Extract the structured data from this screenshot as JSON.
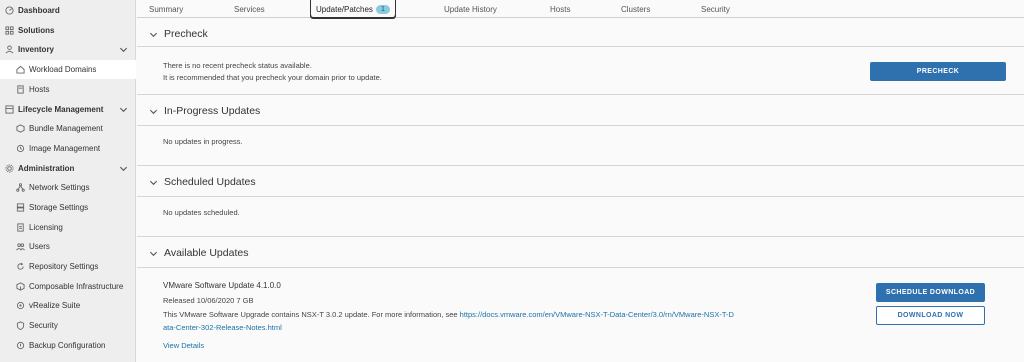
{
  "sidebar": {
    "dashboard": "Dashboard",
    "solutions": "Solutions",
    "inventory": "Inventory",
    "workload_domains": "Workload Domains",
    "hosts": "Hosts",
    "lifecycle": "Lifecycle Management",
    "bundle_management": "Bundle Management",
    "image_management": "Image Management",
    "administration": "Administration",
    "network_settings": "Network Settings",
    "storage_settings": "Storage Settings",
    "licensing": "Licensing",
    "users": "Users",
    "repository_settings": "Repository Settings",
    "composable_infrastructure": "Composable Infrastructure",
    "vrealize_suite": "vRealize Suite",
    "security": "Security",
    "backup_configuration": "Backup Configuration"
  },
  "tabs": {
    "summary": "Summary",
    "services": "Services",
    "update_patches": "Update/Patches",
    "update_patches_badge": "1",
    "update_history": "Update History",
    "hosts": "Hosts",
    "clusters": "Clusters",
    "security": "Security"
  },
  "precheck": {
    "title": "Precheck",
    "line1": "There is no recent precheck status available.",
    "line2": "It is recommended that you precheck your domain prior to update.",
    "button": "PRECHECK"
  },
  "in_progress": {
    "title": "In-Progress Updates",
    "message": "No updates in progress."
  },
  "scheduled": {
    "title": "Scheduled Updates",
    "message": "No updates scheduled."
  },
  "available": {
    "title": "Available Updates",
    "update_name": "VMware Software Update 4.1.0.0",
    "released": "Released 10/06/2020 7 GB",
    "description": "This VMware Software Upgrade contains NSX-T 3.0.2 update. For more information, see ",
    "link_part1": "https://docs.vmware.com/en/VMware-NSX-T-Data-Center/3.0/rn/VMware-NSX-T-D",
    "link_part2": "ata-Center-302-Release-Notes.html",
    "view_details": "View Details",
    "schedule_download": "SCHEDULE DOWNLOAD",
    "download_now": "DOWNLOAD NOW"
  },
  "colors": {
    "accent": "#2e71ae",
    "link": "#1a72a8",
    "badge": "#89cbdf",
    "sidebar_bg": "#eeeeee"
  }
}
